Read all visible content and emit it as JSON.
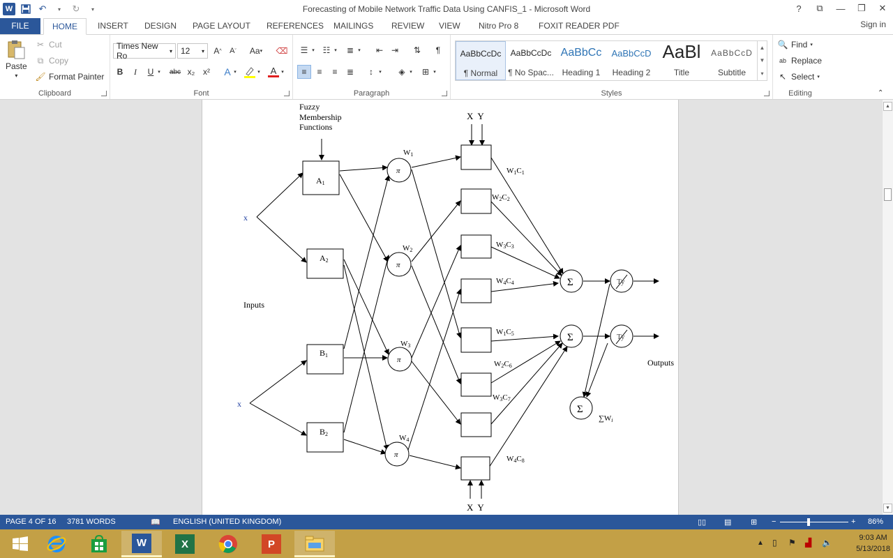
{
  "window": {
    "title": "Forecasting of Mobile Network Traffic Data Using CANFIS_1 - Microsoft Word",
    "help_label": "?",
    "sign_in": "Sign in"
  },
  "tabs": [
    {
      "label": "FILE"
    },
    {
      "label": "HOME"
    },
    {
      "label": "INSERT"
    },
    {
      "label": "DESIGN"
    },
    {
      "label": "PAGE LAYOUT"
    },
    {
      "label": "REFERENCES"
    },
    {
      "label": "MAILINGS"
    },
    {
      "label": "REVIEW"
    },
    {
      "label": "VIEW"
    },
    {
      "label": "Nitro Pro 8"
    },
    {
      "label": "FOXIT READER PDF"
    }
  ],
  "ribbon": {
    "clipboard": {
      "label": "Clipboard",
      "paste": "Paste",
      "cut": "Cut",
      "copy": "Copy",
      "format_painter": "Format Painter"
    },
    "font": {
      "label": "Font",
      "font_name": "Times New Ro",
      "font_size": "12",
      "grow": "A",
      "shrink": "A",
      "change_case": "Aa",
      "bold": "B",
      "italic": "I",
      "underline": "U",
      "strike": "abc",
      "subscript": "x₂",
      "superscript": "x²",
      "effects": "A",
      "font_color": "A",
      "highlight_color": "#ffff00",
      "font_color_value": "#e02020"
    },
    "paragraph": {
      "label": "Paragraph",
      "show_marks": "¶"
    },
    "styles": {
      "label": "Styles",
      "items": [
        {
          "sample": "AaBbCcDc",
          "name": "¶ Normal"
        },
        {
          "sample": "AaBbCcDc",
          "name": "¶ No Spac..."
        },
        {
          "sample": "AaBbCc",
          "name": "Heading 1"
        },
        {
          "sample": "AaBbCcD",
          "name": "Heading 2"
        },
        {
          "sample": "AaBl",
          "name": "Title"
        },
        {
          "sample": "AaBbCcD",
          "name": "Subtitle"
        }
      ]
    },
    "editing": {
      "label": "Editing",
      "find": "Find",
      "replace": "Replace",
      "select": "Select"
    }
  },
  "diagram": {
    "header": "Fuzzy Membership Functions",
    "header_lines": [
      "Fuzzy",
      "Membership",
      "Functions"
    ],
    "input_x_top": "x",
    "input_x_bottom": "x",
    "inputs_label": "Inputs",
    "outputs_label": "Outputs",
    "mf_boxes": [
      {
        "main": "A",
        "sub": "1"
      },
      {
        "main": "A",
        "sub": "2"
      },
      {
        "main": "B",
        "sub": "1"
      },
      {
        "main": "B",
        "sub": "2"
      }
    ],
    "pi_symbol": "π",
    "weights": [
      {
        "main": "W",
        "sub": "1"
      },
      {
        "main": "W",
        "sub": "2"
      },
      {
        "main": "W",
        "sub": "3"
      },
      {
        "main": "W",
        "sub": "4"
      }
    ],
    "xy_top": "X  Y",
    "xy_bottom": "X  Y",
    "consequents": [
      {
        "w": "1",
        "c": "1"
      },
      {
        "w": "2",
        "c": "2"
      },
      {
        "w": "3",
        "c": "3"
      },
      {
        "w": "4",
        "c": "4"
      },
      {
        "w": "1",
        "c": "5"
      },
      {
        "w": "2",
        "c": "6"
      },
      {
        "w": "3",
        "c": "7"
      },
      {
        "w": "4",
        "c": "8"
      }
    ],
    "sigma_symbol": "Σ",
    "ty_label": "Ty",
    "sum_wi": "∑W"
  },
  "status": {
    "page": "PAGE 4 OF 16",
    "words": "3781 WORDS",
    "language": "ENGLISH (UNITED KINGDOM)",
    "zoom": "86%",
    "zoom_value": 0.86
  },
  "tray": {
    "time": "9:03 AM",
    "date": "5/13/2018"
  }
}
